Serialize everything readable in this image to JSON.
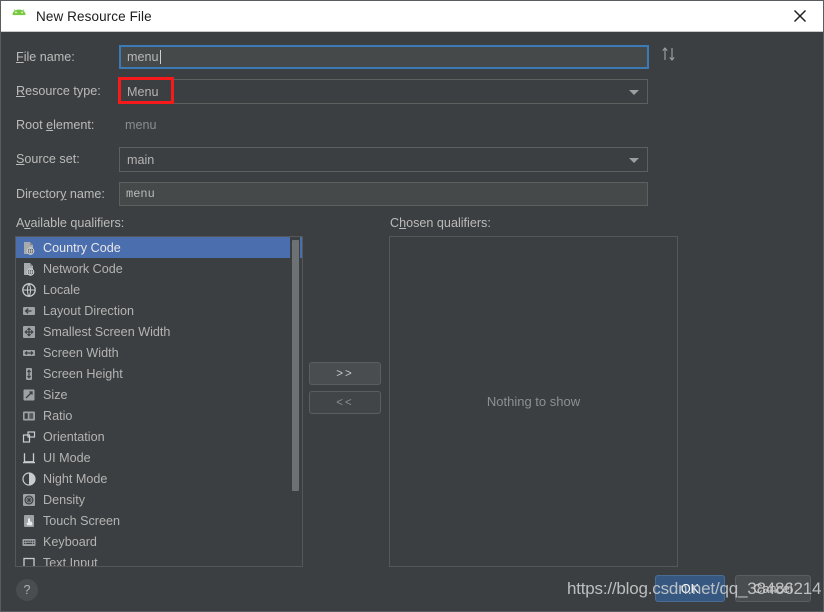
{
  "window": {
    "title": "New Resource File",
    "app_icon": "android-robot-icon",
    "close_icon": "close-icon",
    "titlebar_bg": "#ffffff",
    "dialog_bg": "#3c3f41"
  },
  "form": {
    "file_name": {
      "label_pre": "F",
      "label_post": "ile name:",
      "value": "menu",
      "focused": true
    },
    "resource_type": {
      "label_pre": "R",
      "label_post": "esource type:",
      "value": "Menu",
      "highlight_color": "#f61a1a",
      "arrow_icon": "chevron-down-icon"
    },
    "root_element": {
      "label_a": "Root ",
      "label_mn": "e",
      "label_b": "lement:",
      "value": "menu"
    },
    "source_set": {
      "label_pre": "S",
      "label_post": "ource set:",
      "value": "main",
      "arrow_icon": "chevron-down-icon"
    },
    "directory_name": {
      "label_a": "Director",
      "label_mn": "y",
      "label_b": " name:",
      "value": "menu"
    },
    "sort_icon": "sort-up-down-icon"
  },
  "available": {
    "label_a": "A",
    "label_mn": "v",
    "label_b": "ailable qualifiers:",
    "items": [
      {
        "label": "Country Code",
        "icon": "country-code-icon",
        "selected": true
      },
      {
        "label": "Network Code",
        "icon": "network-code-icon",
        "selected": false
      },
      {
        "label": "Locale",
        "icon": "globe-icon",
        "selected": false
      },
      {
        "label": "Layout Direction",
        "icon": "arrow-left-icon",
        "selected": false
      },
      {
        "label": "Smallest Screen Width",
        "icon": "smallest-screen-width-icon",
        "selected": false
      },
      {
        "label": "Screen Width",
        "icon": "screen-width-icon",
        "selected": false
      },
      {
        "label": "Screen Height",
        "icon": "screen-height-icon",
        "selected": false
      },
      {
        "label": "Size",
        "icon": "size-icon",
        "selected": false
      },
      {
        "label": "Ratio",
        "icon": "ratio-icon",
        "selected": false
      },
      {
        "label": "Orientation",
        "icon": "orientation-icon",
        "selected": false
      },
      {
        "label": "UI Mode",
        "icon": "ui-mode-icon",
        "selected": false
      },
      {
        "label": "Night Mode",
        "icon": "night-mode-icon",
        "selected": false
      },
      {
        "label": "Density",
        "icon": "density-icon",
        "selected": false
      },
      {
        "label": "Touch Screen",
        "icon": "touch-screen-icon",
        "selected": false
      },
      {
        "label": "Keyboard",
        "icon": "keyboard-icon",
        "selected": false
      },
      {
        "label": "Text Input",
        "icon": "text-input-icon",
        "selected": false
      }
    ]
  },
  "transfer": {
    "add_label": ">>",
    "remove_label": "<<"
  },
  "chosen": {
    "label_a": "C",
    "label_mn": "h",
    "label_b": "osen qualifiers:",
    "empty_text": "Nothing to show"
  },
  "footer": {
    "help_label": "?",
    "ok_label": "OK",
    "cancel_label": "Cancel",
    "watermark": "https://blog.csdn.net/qq_38486214"
  }
}
